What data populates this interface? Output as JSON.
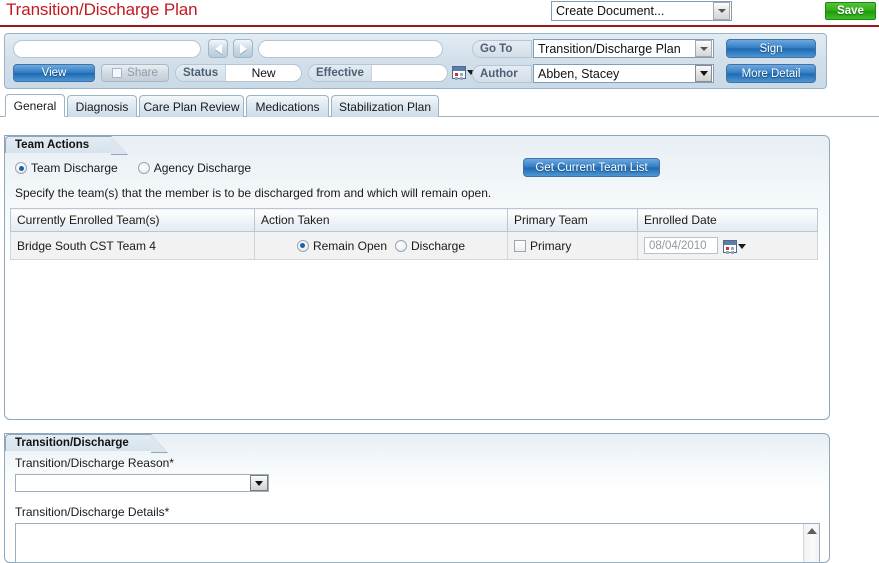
{
  "header": {
    "page_title": "Transition/Discharge Plan",
    "create_document_value": "Create Document...",
    "save_label": "Save",
    "accent_color": "#c3191e",
    "save_color": "#32ab18"
  },
  "toolbar": {
    "left_input_value": "",
    "right_input_value": "",
    "back_icon": "arrow-left-icon",
    "forward_icon": "arrow-right-icon",
    "view_label": "View",
    "share_label": "Share",
    "status_label": "Status",
    "status_value": "New",
    "effective_label": "Effective",
    "effective_value": "",
    "calendar_icon": "calendar-icon",
    "goto_label": "Go To",
    "goto_value": "Transition/Discharge Plan",
    "author_label": "Author",
    "author_value": "Abben, Stacey",
    "sign_label": "Sign",
    "more_detail_label": "More Detail"
  },
  "tabs": [
    {
      "label": "General",
      "active": true
    },
    {
      "label": "Diagnosis",
      "active": false
    },
    {
      "label": "Care Plan Review",
      "active": false
    },
    {
      "label": "Medications",
      "active": false
    },
    {
      "label": "Stabilization Plan",
      "active": false
    }
  ],
  "team_actions": {
    "panel_title": "Team Actions",
    "discharge_type_options": [
      {
        "label": "Team Discharge",
        "selected": true
      },
      {
        "label": "Agency Discharge",
        "selected": false
      }
    ],
    "get_current_team_list_label": "Get Current Team List",
    "instructions": "Specify the team(s) that the member is to be discharged from and which will remain open.",
    "table": {
      "columns": [
        "Currently Enrolled Team(s)",
        "Action Taken",
        "Primary Team",
        "Enrolled Date"
      ],
      "rows": [
        {
          "team": "Bridge South CST Team 4",
          "action_options": [
            {
              "label": "Remain Open",
              "selected": true
            },
            {
              "label": "Discharge",
              "selected": false
            }
          ],
          "primary_label": "Primary",
          "primary_checked": false,
          "enrolled_date": "08/04/2010",
          "calendar_icon": "calendar-icon"
        }
      ]
    }
  },
  "transition_discharge": {
    "panel_title": "Transition/Discharge",
    "reason_label": "Transition/Discharge Reason*",
    "reason_value": "",
    "details_label": "Transition/Discharge Details*",
    "details_value": "",
    "scroll_up_icon": "scroll-up-icon"
  }
}
